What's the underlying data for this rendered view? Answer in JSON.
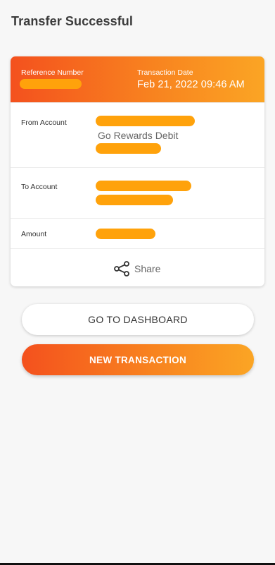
{
  "page": {
    "title": "Transfer Successful"
  },
  "receipt": {
    "reference_label": "Reference Number",
    "transaction_date_label": "Transaction Date",
    "transaction_date_value": "Feb 21, 2022 09:46 AM",
    "from_account_label": "From Account",
    "from_account_type": "Go Rewards Debit",
    "to_account_label": "To Account",
    "amount_label": "Amount",
    "share_label": "Share"
  },
  "actions": {
    "dashboard_label": "GO TO DASHBOARD",
    "new_transaction_label": "NEW TRANSACTION"
  },
  "colors": {
    "accent_start": "#f4511e",
    "accent_end": "#fba524",
    "redaction_mask": "#ffa20b"
  },
  "icons": {
    "share": "share-icon"
  }
}
